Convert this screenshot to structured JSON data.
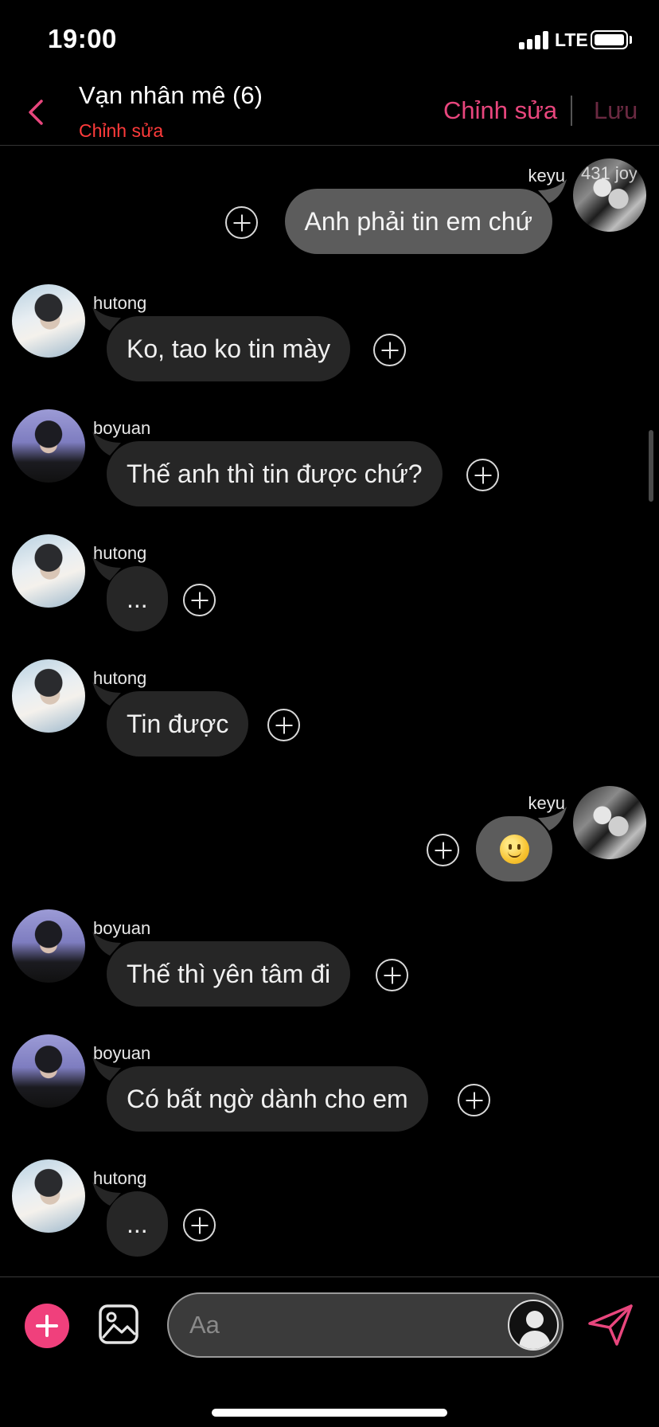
{
  "status_bar": {
    "time": "19:00",
    "network": "LTE"
  },
  "header": {
    "title": "Vạn nhân mê (6)",
    "subtitle": "Chỉnh sửa",
    "edit_label": "Chỉnh sửa",
    "save_label": "Lưu"
  },
  "colors": {
    "accent": "#e8467d",
    "subtitle": "#ff3b3b",
    "incoming_bubble": "#262626",
    "outgoing_bubble": "#5c5c5c",
    "background": "#000000"
  },
  "messages": [
    {
      "sender": "keyu",
      "text": "Anh phải tin em chứ",
      "direction": "outgoing",
      "avatar_watermark": "431 joy"
    },
    {
      "sender": "hutong",
      "text": "Ko, tao ko tin mày",
      "direction": "incoming"
    },
    {
      "sender": "boyuan",
      "text": "Thế anh thì tin được chứ?",
      "direction": "incoming"
    },
    {
      "sender": "hutong",
      "text": "...",
      "direction": "incoming"
    },
    {
      "sender": "hutong",
      "text": "Tin được",
      "direction": "incoming"
    },
    {
      "sender": "keyu",
      "text": "",
      "emoji": "slightly-smiling-face",
      "direction": "outgoing"
    },
    {
      "sender": "boyuan",
      "text": "Thế thì yên tâm đi",
      "direction": "incoming"
    },
    {
      "sender": "boyuan",
      "text": "Có bất ngờ dành cho em",
      "direction": "incoming"
    },
    {
      "sender": "hutong",
      "text": "...",
      "direction": "incoming"
    }
  ],
  "composer": {
    "placeholder": "Aa",
    "icons": {
      "add": "plus-circle-icon",
      "image": "image-icon",
      "persona": "user-silhouette-icon",
      "send": "paper-plane-icon"
    }
  }
}
